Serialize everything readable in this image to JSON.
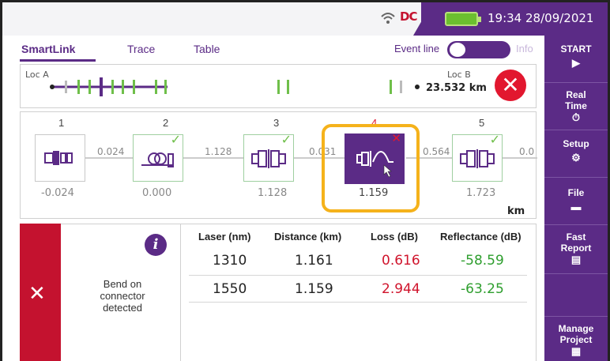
{
  "status_bar": {
    "time": "19:34",
    "date": "28/09/2021",
    "logo": "DC"
  },
  "tabs": [
    "SmartLink",
    "Trace",
    "Table"
  ],
  "event_line": {
    "label": "Event line",
    "info_label": "Info"
  },
  "link": {
    "loc_a": "Loc A",
    "loc_b": "Loc B",
    "total_distance": "23.532 km"
  },
  "map": {
    "events": [
      {
        "number": "1",
        "position": "-0.024",
        "icon": "fiber-start-connector-icon",
        "status": "none"
      },
      {
        "number": "2",
        "position": "0.000",
        "icon": "fiber-coil-connector-icon",
        "status": "ok"
      },
      {
        "number": "3",
        "position": "1.128",
        "icon": "connector-icon",
        "status": "ok"
      },
      {
        "number": "4",
        "position": "1.159",
        "icon": "bend-connector-icon",
        "status": "fail"
      },
      {
        "number": "5",
        "position": "1.723",
        "icon": "connector-icon",
        "status": "ok"
      }
    ],
    "segments": [
      "0.024",
      "1.128",
      "0.031",
      "0.564",
      "0.0"
    ],
    "unit": "km"
  },
  "alert": {
    "text_line1": "Bend on",
    "text_line2": "connector",
    "text_line3": "detected",
    "info_icon": "i"
  },
  "table": {
    "headers": [
      "Laser (nm)",
      "Distance (km)",
      "Loss (dB)",
      "Reflectance (dB)"
    ],
    "rows": [
      {
        "laser": "1310",
        "distance": "1.161",
        "loss": "0.616",
        "reflectance": "-58.59"
      },
      {
        "laser": "1550",
        "distance": "1.159",
        "loss": "2.944",
        "reflectance": "-63.25"
      }
    ]
  },
  "sidebar": {
    "start": "START",
    "realtime_1": "Real",
    "realtime_2": "Time",
    "setup": "Setup",
    "file": "File",
    "fastreport_1": "Fast",
    "fastreport_2": "Report",
    "manage_1": "Manage",
    "manage_2": "Project"
  },
  "colors": {
    "accent": "#5b2b86",
    "error": "#e2172f",
    "ok": "#6fbf4a",
    "highlight": "#f5b21b"
  }
}
